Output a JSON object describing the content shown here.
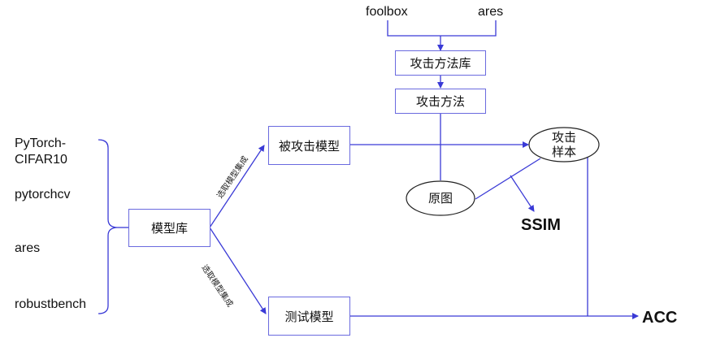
{
  "sources": {
    "foolbox": "foolbox",
    "ares_top": "ares"
  },
  "attack_library": "攻击方法库",
  "attack_method": "攻击方法",
  "attacked_model": "被攻击模型",
  "test_model": "测试模型",
  "model_library": "模型库",
  "original_image": "原图",
  "adversarial_sample": [
    "攻击",
    "样本"
  ],
  "metrics": {
    "ssim": "SSIM",
    "acc": "ACC"
  },
  "model_sources": [
    "PyTorch-",
    "CIFAR10",
    "pytorchcv",
    "ares",
    "robustbench"
  ],
  "edge_labels": {
    "upper": "选取模型集成",
    "lower": "选取模型集成"
  },
  "colors": {
    "line": "#3a3ad6",
    "box_border": "#6a6adf",
    "text": "#111111"
  }
}
